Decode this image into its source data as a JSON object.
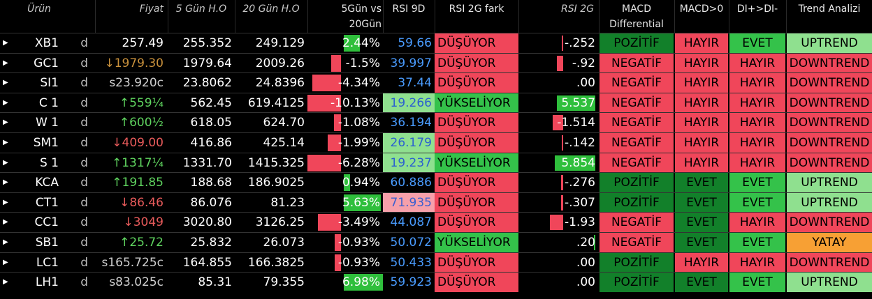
{
  "headers": {
    "urun": "Ürün",
    "fiyat": "Fiyat",
    "h5": "5 Gün H.O",
    "h20": "20 Gün H.O",
    "pct_line1": "5Gün vs",
    "pct_line2": "20Gün",
    "rsi9": "RSI 9D",
    "fark": "RSI 2G fark",
    "rsi2g": "RSI 2G",
    "macd_line1": "MACD",
    "macd_line2": "Differential",
    "macd0": "MACD>0",
    "di": "DI+>DI-",
    "trend": "Trend Analizi"
  },
  "rows": [
    {
      "sym": "XB1",
      "per": "d",
      "price": "257.49",
      "price_color": "white",
      "h5": "255.352",
      "h20": "249.129",
      "pct": "2.44%",
      "pct_val": 2.44,
      "rsi9": "59.66",
      "rsi_bg": "",
      "fark": "DÜŞÜYOR",
      "r2g": "-.252",
      "r2g_val": -0.252,
      "macd": "POZİTİF",
      "macd0": "HAYIR",
      "di": "EVET",
      "trend": "UPTREND"
    },
    {
      "sym": "GC1",
      "per": "d",
      "price": "↓1979.30",
      "price_color": "brown",
      "h5": "1979.64",
      "h20": "2009.26",
      "pct": "-1.5%",
      "pct_val": -1.5,
      "rsi9": "39.997",
      "rsi_bg": "",
      "fark": "DÜŞÜYOR",
      "r2g": "-.92",
      "r2g_val": -0.92,
      "macd": "NEGATİF",
      "macd0": "HAYIR",
      "di": "HAYIR",
      "trend": "DOWNTREND"
    },
    {
      "sym": "SI1",
      "per": "d",
      "price": "s23.920c",
      "price_color": "gray",
      "h5": "23.8062",
      "h20": "24.8396",
      "pct": "-4.34%",
      "pct_val": -4.34,
      "rsi9": "37.44",
      "rsi_bg": "",
      "fark": "DÜŞÜYOR",
      "r2g": ".00",
      "r2g_val": 0,
      "macd": "NEGATİF",
      "macd0": "HAYIR",
      "di": "HAYIR",
      "trend": "DOWNTREND"
    },
    {
      "sym": "C 1",
      "per": "d",
      "price": "↑559¼",
      "price_color": "green",
      "h5": "562.45",
      "h20": "619.4125",
      "pct": "-10.13%",
      "pct_val": -10.13,
      "rsi9": "19.266",
      "rsi_bg": "lg",
      "fark": "YÜKSELİYOR",
      "r2g": "5.537",
      "r2g_val": 5.537,
      "macd": "NEGATİF",
      "macd0": "HAYIR",
      "di": "HAYIR",
      "trend": "DOWNTREND"
    },
    {
      "sym": "W 1",
      "per": "d",
      "price": "↑600½",
      "price_color": "green",
      "h5": "618.05",
      "h20": "624.70",
      "pct": "-1.08%",
      "pct_val": -1.08,
      "rsi9": "36.194",
      "rsi_bg": "",
      "fark": "DÜŞÜYOR",
      "r2g": "-1.514",
      "r2g_val": -1.514,
      "macd": "NEGATİF",
      "macd0": "HAYIR",
      "di": "HAYIR",
      "trend": "DOWNTREND"
    },
    {
      "sym": "SM1",
      "per": "d",
      "price": "↓409.00",
      "price_color": "red",
      "h5": "416.86",
      "h20": "425.14",
      "pct": "-1.99%",
      "pct_val": -1.99,
      "rsi9": "26.179",
      "rsi_bg": "lg",
      "fark": "DÜŞÜYOR",
      "r2g": "-.142",
      "r2g_val": -0.142,
      "macd": "NEGATİF",
      "macd0": "HAYIR",
      "di": "HAYIR",
      "trend": "DOWNTREND"
    },
    {
      "sym": "S 1",
      "per": "d",
      "price": "↑1317¼",
      "price_color": "green",
      "h5": "1331.70",
      "h20": "1415.325",
      "pct": "-6.28%",
      "pct_val": -6.28,
      "rsi9": "19.237",
      "rsi_bg": "lg",
      "fark": "YÜKSELİYOR",
      "r2g": "5.854",
      "r2g_val": 5.854,
      "macd": "NEGATİF",
      "macd0": "HAYIR",
      "di": "HAYIR",
      "trend": "DOWNTREND"
    },
    {
      "sym": "KCA",
      "per": "d",
      "price": "↑191.85",
      "price_color": "green",
      "h5": "188.68",
      "h20": "186.9025",
      "pct": "0.94%",
      "pct_val": 0.94,
      "rsi9": "60.886",
      "rsi_bg": "",
      "fark": "DÜŞÜYOR",
      "r2g": "-.276",
      "r2g_val": -0.276,
      "macd": "POZİTİF",
      "macd0": "EVET",
      "di": "EVET",
      "trend": "UPTREND"
    },
    {
      "sym": "CT1",
      "per": "d",
      "price": "↓86.46",
      "price_color": "red",
      "h5": "86.076",
      "h20": "81.23",
      "pct": "5.63%",
      "pct_val": 5.63,
      "rsi9": "71.935",
      "rsi_bg": "pk",
      "fark": "DÜŞÜYOR",
      "r2g": "-.307",
      "r2g_val": -0.307,
      "macd": "POZİTİF",
      "macd0": "EVET",
      "di": "EVET",
      "trend": "UPTREND"
    },
    {
      "sym": "CC1",
      "per": "d",
      "price": "↓3049",
      "price_color": "red",
      "h5": "3020.80",
      "h20": "3126.25",
      "pct": "-3.49%",
      "pct_val": -3.49,
      "rsi9": "44.087",
      "rsi_bg": "",
      "fark": "DÜŞÜYOR",
      "r2g": "-1.93",
      "r2g_val": -1.93,
      "macd": "NEGATİF",
      "macd0": "EVET",
      "di": "HAYIR",
      "trend": "DOWNTREND"
    },
    {
      "sym": "SB1",
      "per": "d",
      "price": "↑25.72",
      "price_color": "green",
      "h5": "25.832",
      "h20": "26.073",
      "pct": "-0.93%",
      "pct_val": -0.93,
      "rsi9": "50.072",
      "rsi_bg": "",
      "fark": "YÜKSELİYOR",
      "r2g": ".20",
      "r2g_val": 0.2,
      "macd": "NEGATİF",
      "macd0": "EVET",
      "di": "EVET",
      "trend": "YATAY"
    },
    {
      "sym": "LC1",
      "per": "d",
      "price": "s165.725c",
      "price_color": "gray",
      "h5": "164.855",
      "h20": "166.3825",
      "pct": "-0.93%",
      "pct_val": -0.93,
      "rsi9": "50.433",
      "rsi_bg": "",
      "fark": "DÜŞÜYOR",
      "r2g": ".00",
      "r2g_val": 0,
      "macd": "POZİTİF",
      "macd0": "HAYIR",
      "di": "HAYIR",
      "trend": "DOWNTREND"
    },
    {
      "sym": "LH1",
      "per": "d",
      "price": "s83.025c",
      "price_color": "gray",
      "h5": "85.31",
      "h20": "79.355",
      "pct": "6.98%",
      "pct_val": 6.98,
      "rsi9": "59.923",
      "rsi_bg": "",
      "fark": "DÜŞÜYOR",
      "r2g": ".00",
      "r2g_val": 0,
      "macd": "POZİTİF",
      "macd0": "EVET",
      "di": "EVET",
      "trend": "UPTREND"
    }
  ]
}
